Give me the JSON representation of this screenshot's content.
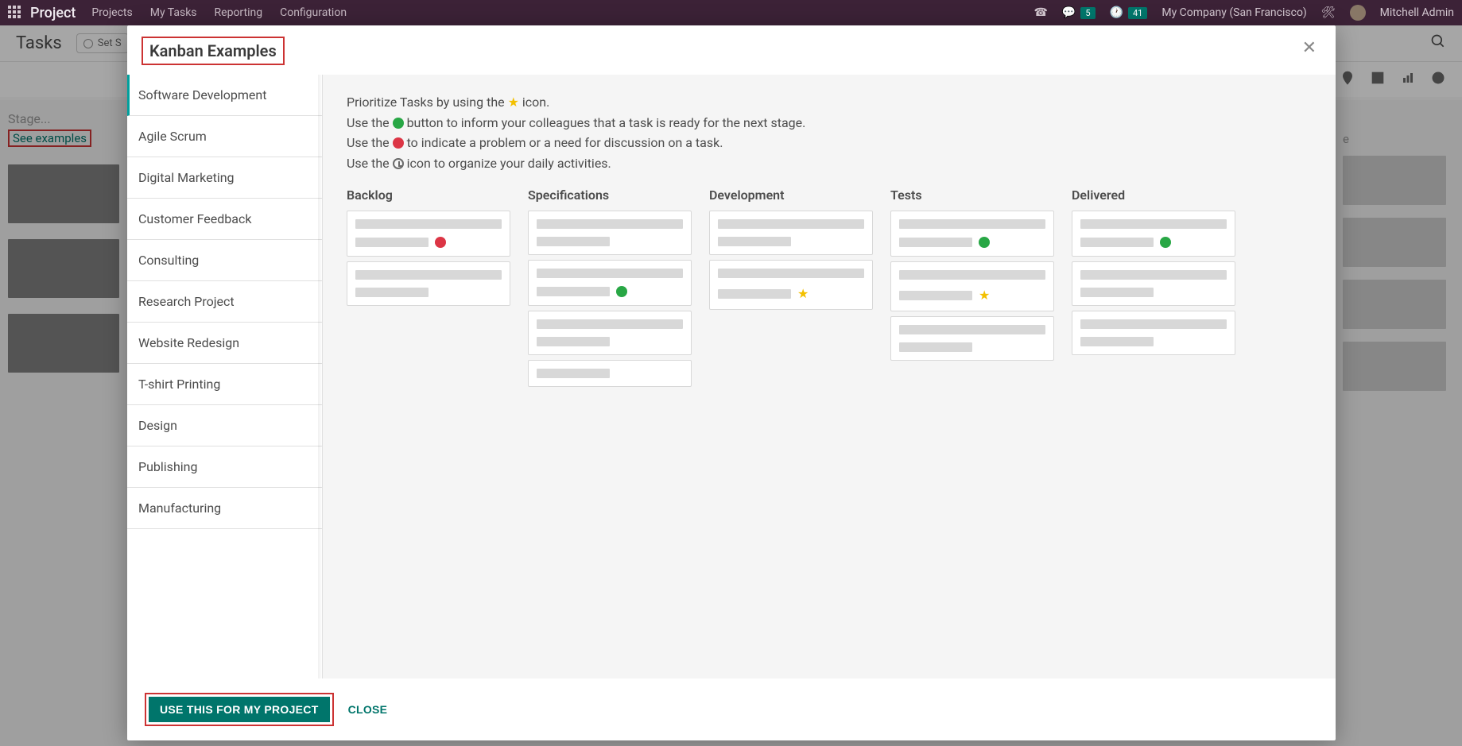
{
  "topbar": {
    "brand": "Project",
    "menu": [
      "Projects",
      "My Tasks",
      "Reporting",
      "Configuration"
    ],
    "badge_messages": "5",
    "badge_activities": "41",
    "company": "My Company (San Francisco)",
    "user": "Mitchell Admin"
  },
  "controlbar": {
    "title": "Tasks",
    "pill_label": "Set S"
  },
  "bg": {
    "stage_label": "Stage...",
    "see_examples_label": "See examples",
    "right_col_title": "e"
  },
  "modal": {
    "title": "Kanban Examples",
    "sidebar_items": [
      "Software Development",
      "Agile Scrum",
      "Digital Marketing",
      "Customer Feedback",
      "Consulting",
      "Research Project",
      "Website Redesign",
      "T-shirt Printing",
      "Design",
      "Publishing",
      "Manufacturing"
    ],
    "active_sidebar_index": 0,
    "instructions": {
      "l1a": "Prioritize Tasks by using the ",
      "l1b": " icon.",
      "l2a": "Use the ",
      "l2b": " button to inform your colleagues that a task is ready for the next stage.",
      "l3a": "Use the ",
      "l3b": " to indicate a problem or a need for discussion on a task.",
      "l4a": "Use the ",
      "l4b": " icon to organize your daily activities."
    },
    "columns": [
      {
        "title": "Backlog",
        "cards": [
          {
            "marker": "red"
          },
          {
            "marker": "none",
            "lines": 2
          }
        ]
      },
      {
        "title": "Specifications",
        "cards": [
          {
            "marker": "none"
          },
          {
            "marker": "green"
          },
          {
            "marker": "none"
          },
          {
            "marker": "none",
            "lines": 1,
            "half_only": true
          }
        ]
      },
      {
        "title": "Development",
        "cards": [
          {
            "marker": "none"
          },
          {
            "marker": "star"
          }
        ]
      },
      {
        "title": "Tests",
        "cards": [
          {
            "marker": "green"
          },
          {
            "marker": "star"
          },
          {
            "marker": "none"
          }
        ]
      },
      {
        "title": "Delivered",
        "cards": [
          {
            "marker": "green"
          },
          {
            "marker": "none"
          },
          {
            "marker": "none"
          }
        ]
      }
    ],
    "footer": {
      "primary": "USE THIS FOR MY PROJECT",
      "close": "CLOSE"
    }
  }
}
